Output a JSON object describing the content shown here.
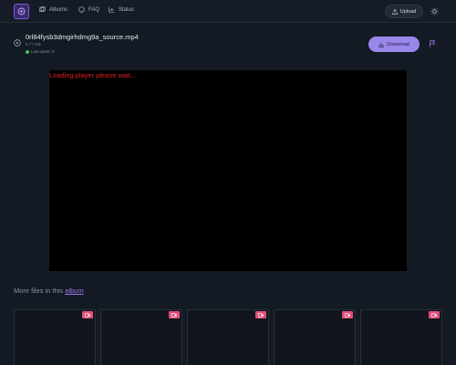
{
  "nav": {
    "albums": "Albums",
    "faq": "FAQ",
    "status": "Status",
    "upload": "Upload"
  },
  "file": {
    "name": "0rl84fysb3dmgirhdmg9a_source.mp4",
    "size": "5.77 MB",
    "live_users": "Live users: 0",
    "download": "Download"
  },
  "player": {
    "message": "Loading player please wait..."
  },
  "more": {
    "prefix": "More files in this ",
    "link": "album"
  },
  "thumbnails": [
    {
      "type": "video"
    },
    {
      "type": "video"
    },
    {
      "type": "video"
    },
    {
      "type": "video"
    },
    {
      "type": "video"
    }
  ],
  "colors": {
    "accent": "#9a87ea",
    "background": "#141a23",
    "loading_text": "#e02020",
    "video_tag": "#e24d78",
    "live_dot": "#3fbf5a"
  }
}
